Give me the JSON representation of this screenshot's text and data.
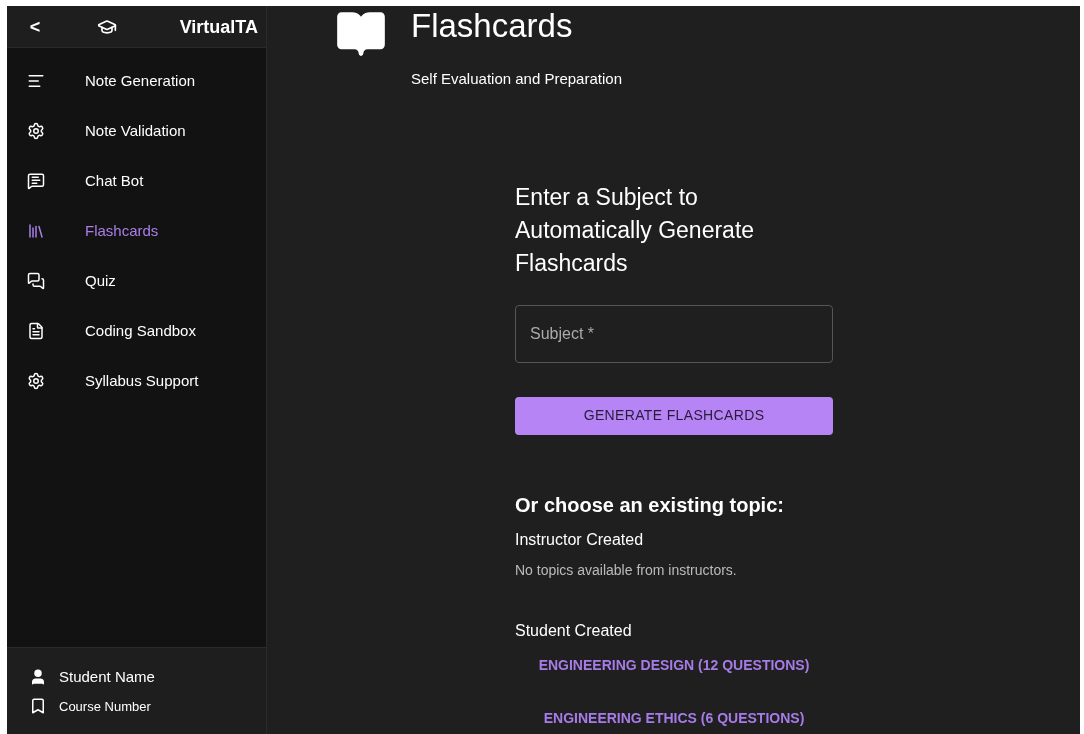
{
  "sidebar": {
    "back": "<",
    "brand": "VirtualTA",
    "items": [
      {
        "label": "Note Generation",
        "selected": false
      },
      {
        "label": "Note Validation",
        "selected": false
      },
      {
        "label": "Chat Bot",
        "selected": false
      },
      {
        "label": "Flashcards",
        "selected": true
      },
      {
        "label": "Quiz",
        "selected": false
      },
      {
        "label": "Coding Sandbox",
        "selected": false
      },
      {
        "label": "Syllabus Support",
        "selected": false
      }
    ],
    "footer": {
      "student": "Student Name",
      "course": "Course Number"
    }
  },
  "header": {
    "title": "Flashcards",
    "subtitle": "Self Evaluation and Preparation"
  },
  "form": {
    "heading": "Enter a Subject to Automatically Generate Flashcards",
    "subject_placeholder": "Subject *",
    "button": "GENERATE FLASHCARDS"
  },
  "topics": {
    "heading": "Or choose an existing topic:",
    "instructor": {
      "title": "Instructor Created",
      "empty": "No topics available from instructors."
    },
    "student": {
      "title": "Student Created",
      "items": [
        "ENGINEERING DESIGN (12 QUESTIONS)",
        "ENGINEERING ETHICS (6 QUESTIONS)"
      ]
    }
  }
}
